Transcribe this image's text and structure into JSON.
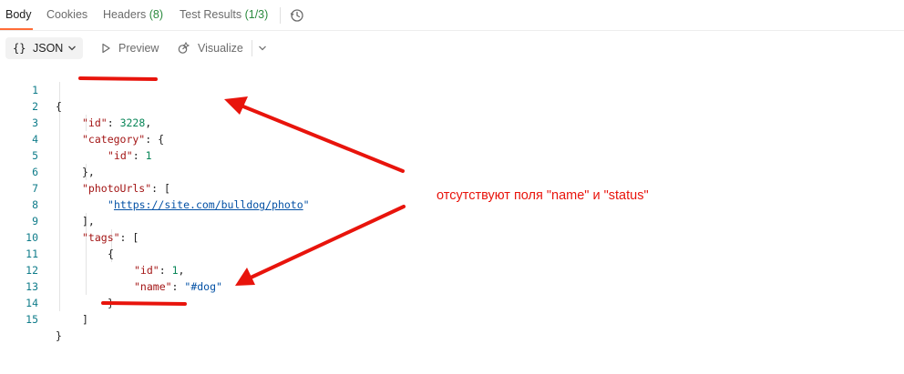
{
  "tabs": [
    {
      "label": "Body"
    },
    {
      "label": "Cookies"
    },
    {
      "label": "Headers",
      "count": "(8)"
    },
    {
      "label": "Test Results",
      "count": "(1/3)"
    }
  ],
  "toolbar": {
    "format": "JSON",
    "preview": "Preview",
    "visualize": "Visualize"
  },
  "editor": {
    "lines": [
      {
        "n": "1"
      },
      {
        "n": "2"
      },
      {
        "n": "3"
      },
      {
        "n": "4"
      },
      {
        "n": "5"
      },
      {
        "n": "6"
      },
      {
        "n": "7"
      },
      {
        "n": "8"
      },
      {
        "n": "9"
      },
      {
        "n": "10"
      },
      {
        "n": "11"
      },
      {
        "n": "12"
      },
      {
        "n": "13"
      },
      {
        "n": "14"
      },
      {
        "n": "15"
      }
    ],
    "tokens": {
      "open_brace": "{",
      "key_id": "\"id\"",
      "colon": ": ",
      "val_3228": "3228",
      "comma": ",",
      "key_category": "\"category\"",
      "open_inner": "{",
      "key_id_inner": "\"id\"",
      "val_1": "1",
      "close_obj_comma": "},",
      "key_photo": "\"photoUrls\"",
      "open_bracket": "[",
      "quote": "\"",
      "url": "https://site.com/bulldog/photo",
      "close_arr_comma": "],",
      "key_tags": "\"tags\"",
      "tag_open": "{",
      "key_id_tag": "\"id\"",
      "val_tag_1": "1",
      "key_name": "\"name\"",
      "val_dog": "\"#dog\"",
      "tag_close": "}",
      "close_bracket": "]",
      "close_brace": "}"
    }
  },
  "annotation": {
    "text": "отсутствуют поля \"name\" и \"status\"",
    "color": "#e8140c"
  }
}
